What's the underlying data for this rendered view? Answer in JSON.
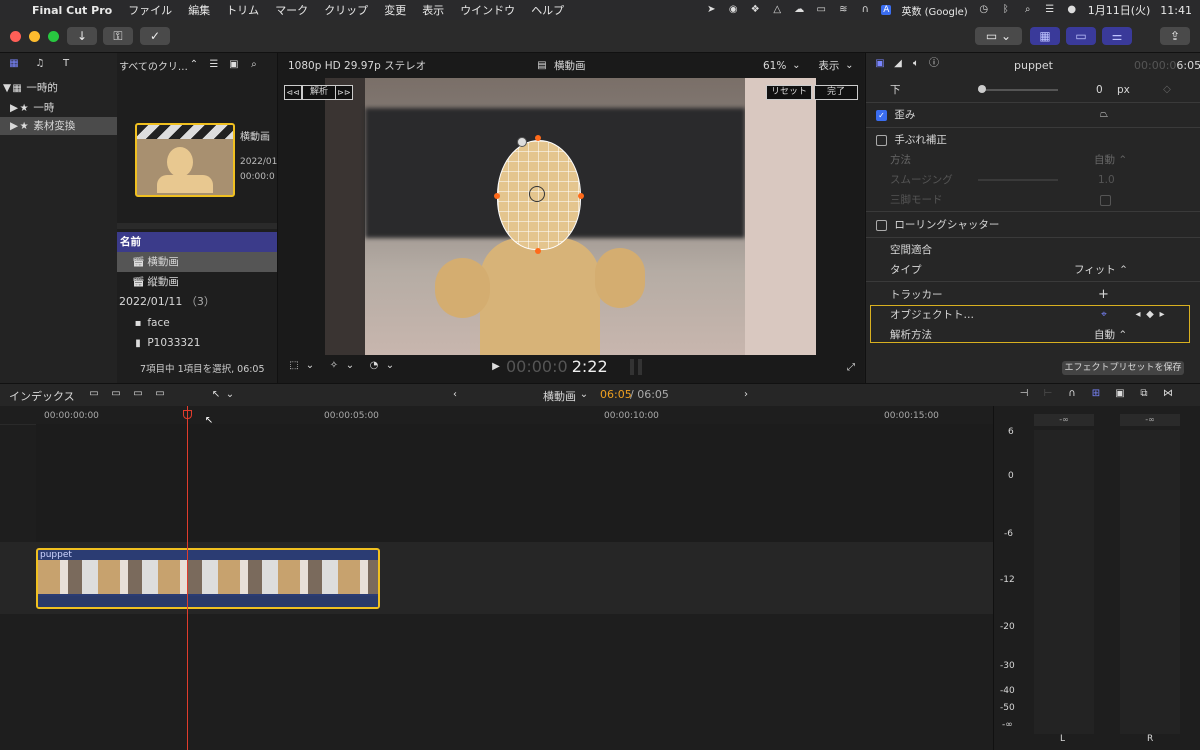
{
  "menubar": {
    "app": "Final Cut Pro",
    "items": [
      "ファイル",
      "編集",
      "トリム",
      "マーク",
      "クリップ",
      "変更",
      "表示",
      "ウインドウ",
      "ヘルプ"
    ],
    "input_source": "英数 (Google)",
    "date": "1月11日(火)",
    "time": "11:41"
  },
  "browser": {
    "filter_label": "すべてのクリ…",
    "sidebar_items": [
      "一時的",
      "一時",
      "素材変換"
    ],
    "thumb_title": "横動画",
    "thumb_date": "2022/01",
    "thumb_time": "00:00:0",
    "list_header": "名前",
    "list_items": [
      "横動画",
      "縦動画"
    ],
    "group_label": "2022/01/11",
    "group_count": "（3）",
    "group_items": [
      "face",
      "P1033321"
    ],
    "status": "7項目中 1項目を選択, 06:05"
  },
  "viewer": {
    "format": "1080p HD 29.97p ステレオ",
    "clip_title": "横動画",
    "zoom": "61%",
    "view_menu": "表示",
    "analyze_label": "解析",
    "reset_label": "リセット",
    "done_label": "完了",
    "timecode_dim": "00:00:0",
    "timecode": "2:22"
  },
  "inspector": {
    "clip_name": "puppet",
    "duration_dim": "00:00:0",
    "duration": "6:05",
    "bottom_label": "下",
    "bottom_value": "0",
    "bottom_unit": "px",
    "distort_label": "歪み",
    "stabilize_label": "手ぶれ補正",
    "method_label": "方法",
    "method_value": "自動 ⌃",
    "smoothing_label": "スムージング",
    "smoothing_value": "1.0",
    "tripod_label": "三脚モード",
    "rolling_label": "ローリングシャッター",
    "spatial_label": "空間適合",
    "type_label": "タイプ",
    "type_value": "フィット ⌃",
    "tracker_label": "トラッカー",
    "tracker_add": "+",
    "object_label": "オブジェクトト…",
    "analysis_label": "解析方法",
    "analysis_value": "自動 ⌃",
    "save_preset": "エフェクトプリセットを保存"
  },
  "timeline": {
    "index_label": "インデックス",
    "project_name": "横動画",
    "position": "06:05",
    "total": "/ 06:05",
    "ruler": [
      "00:00:00:00",
      "00:00:05:00",
      "00:00:10:00",
      "00:00:15:00"
    ],
    "clip_name": "puppet"
  },
  "meters": {
    "peak_l": "-∞",
    "peak_r": "-∞",
    "scale": [
      "6",
      "0",
      "-6",
      "-12",
      "-20",
      "-30",
      "-40",
      "-50",
      "-∞"
    ],
    "ch_l": "L",
    "ch_r": "R"
  }
}
